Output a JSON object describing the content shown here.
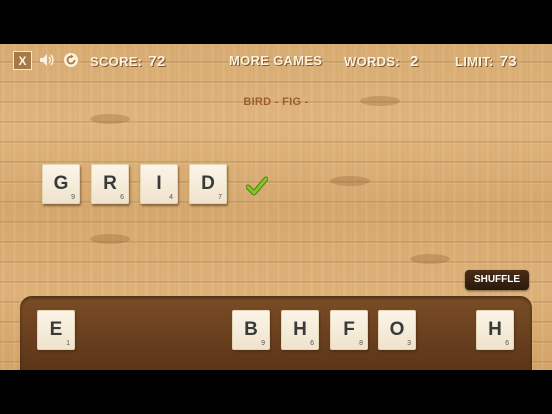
{
  "hud": {
    "score_label": "SCORE:",
    "score_value": "72",
    "more_games": "MORE GAMES",
    "words_label": "WORDS:",
    "words_value": "2",
    "limit_label": "LIMIT:",
    "limit_value": "73"
  },
  "buttons": {
    "close_label": "X",
    "shuffle_label": "SHUFFLE"
  },
  "icons": {
    "sound": "speaker-icon",
    "restart": "refresh-icon",
    "check": "checkmark-icon"
  },
  "found_words": "BIRD - FIG -",
  "current_word": [
    {
      "letter": "G",
      "score": "9"
    },
    {
      "letter": "R",
      "score": "6"
    },
    {
      "letter": "I",
      "score": "4"
    },
    {
      "letter": "D",
      "score": "7"
    }
  ],
  "rack": [
    {
      "letter": "E",
      "score": "1"
    },
    {
      "letter": "B",
      "score": "9"
    },
    {
      "letter": "H",
      "score": "6"
    },
    {
      "letter": "F",
      "score": "8"
    },
    {
      "letter": "O",
      "score": "3"
    },
    {
      "letter": "H",
      "score": "6"
    }
  ],
  "colors": {
    "wood": "#dcae74",
    "tray": "#6b411f",
    "tile": "#f5ecd9",
    "check": "#6fa81c"
  }
}
